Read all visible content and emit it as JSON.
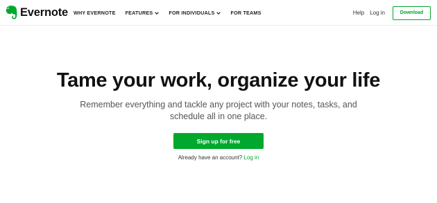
{
  "brand": {
    "name": "Evernote",
    "color": "#00a82d",
    "icon": "evernote-elephant-icon"
  },
  "nav": {
    "links": [
      {
        "label": "WHY EVERNOTE",
        "dropdown": false
      },
      {
        "label": "FEATURES",
        "dropdown": true
      },
      {
        "label": "FOR INDIVIDUALS",
        "dropdown": true
      },
      {
        "label": "FOR TEAMS",
        "dropdown": false
      }
    ],
    "help": "Help",
    "login": "Log in",
    "download": "Download"
  },
  "hero": {
    "title": "Tame your work, organize your life",
    "subtitle": "Remember everything and tackle any project with your notes, tasks, and schedule all in one place.",
    "cta": "Sign up for free",
    "account_prompt": "Already have an account?",
    "account_login": "Log in"
  }
}
